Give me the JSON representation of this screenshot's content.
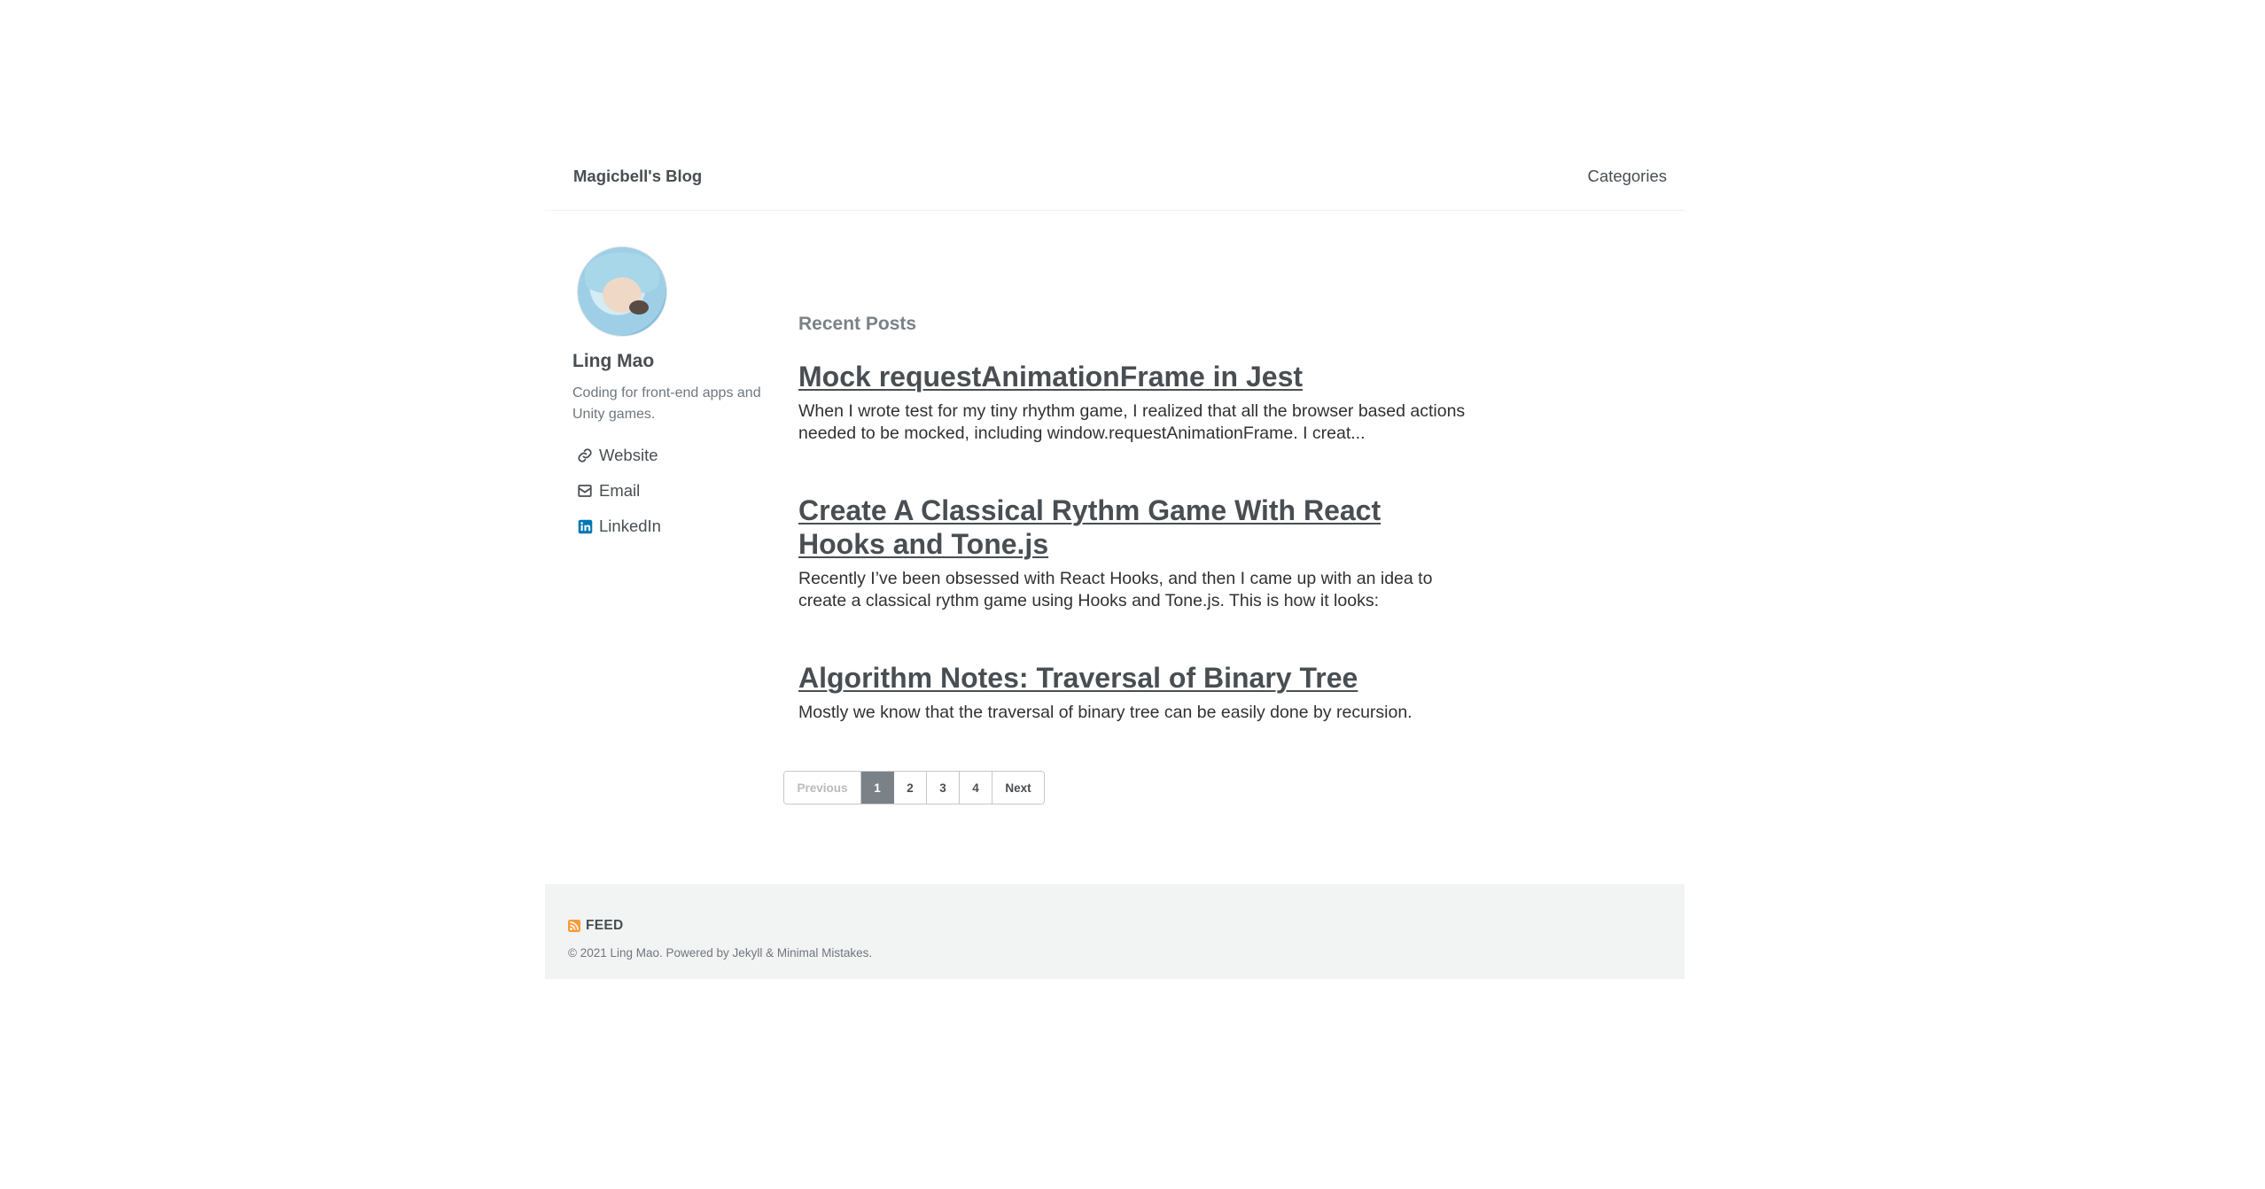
{
  "header": {
    "site_title": "Magicbell's Blog",
    "nav": [
      {
        "label": "Categories"
      }
    ]
  },
  "sidebar": {
    "author_name": "Ling Mao",
    "author_bio": "Coding for front-end apps and Unity games.",
    "links": [
      {
        "label": "Website",
        "icon": "link-icon"
      },
      {
        "label": "Email",
        "icon": "envelope-icon"
      },
      {
        "label": "LinkedIn",
        "icon": "linkedin-icon"
      }
    ]
  },
  "main": {
    "section_title": "Recent Posts",
    "posts": [
      {
        "title": "Mock requestAnimationFrame in Jest",
        "excerpt": "When I wrote test for my tiny rhythm game, I realized that all the browser based actions needed to be mocked, including window.requestAnimationFrame. I creat..."
      },
      {
        "title": "Create A Classical Rythm Game With React Hooks and Tone.js",
        "excerpt": "Recently I’ve been obsessed with React Hooks, and then I came up with an idea to create a classical rythm game using Hooks and Tone.js. This is how it looks:"
      },
      {
        "title": "Algorithm Notes: Traversal of Binary Tree",
        "excerpt": "Mostly we know that the traversal of binary tree can be easily done by recursion."
      }
    ]
  },
  "pagination": {
    "previous": "Previous",
    "pages": [
      "1",
      "2",
      "3",
      "4"
    ],
    "current": "1",
    "next": "Next"
  },
  "footer": {
    "feed_label": "FEED",
    "copyright": "© 2021 Ling Mao. Powered by Jekyll & Minimal Mistakes."
  },
  "colors": {
    "text": "#494e52",
    "muted": "#7a8288",
    "footer_bg": "#f2f3f3",
    "linkedin": "#0077b5",
    "feed": "#fa9b39"
  }
}
